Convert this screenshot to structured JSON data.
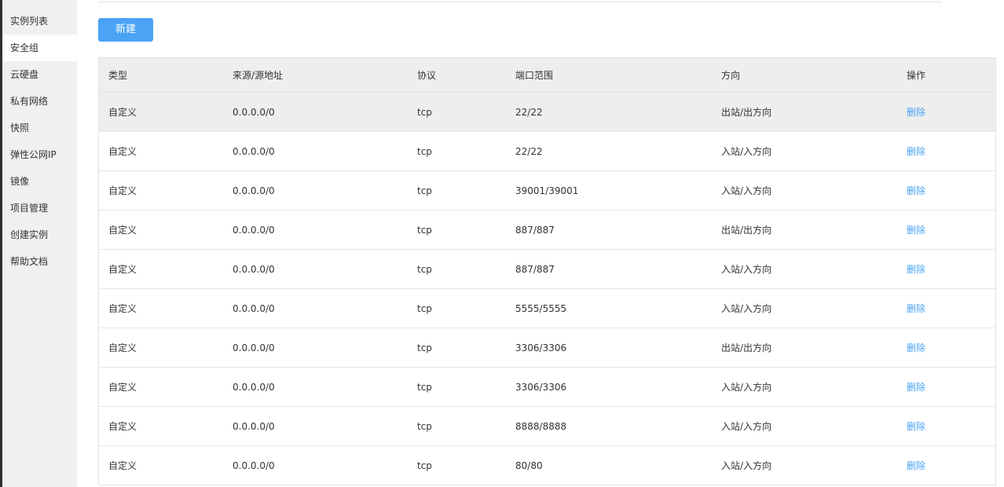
{
  "sidebar": {
    "items": [
      {
        "label": "实例列表"
      },
      {
        "label": "安全组"
      },
      {
        "label": "云硬盘"
      },
      {
        "label": "私有网络"
      },
      {
        "label": "快照"
      },
      {
        "label": "弹性公网IP"
      },
      {
        "label": "镜像"
      },
      {
        "label": "项目管理"
      },
      {
        "label": "创建实例"
      },
      {
        "label": "帮助文档"
      }
    ],
    "active_index": 1
  },
  "toolbar": {
    "new_label": "新建"
  },
  "table": {
    "headers": [
      "类型",
      "来源/源地址",
      "协议",
      "端口范围",
      "方向",
      "操作"
    ],
    "rows": [
      {
        "type": "自定义",
        "source": "0.0.0.0/0",
        "protocol": "tcp",
        "port": "22/22",
        "direction": "出站/出方向",
        "action": "删除"
      },
      {
        "type": "自定义",
        "source": "0.0.0.0/0",
        "protocol": "tcp",
        "port": "22/22",
        "direction": "入站/入方向",
        "action": "删除"
      },
      {
        "type": "自定义",
        "source": "0.0.0.0/0",
        "protocol": "tcp",
        "port": "39001/39001",
        "direction": "入站/入方向",
        "action": "删除"
      },
      {
        "type": "自定义",
        "source": "0.0.0.0/0",
        "protocol": "tcp",
        "port": "887/887",
        "direction": "出站/出方向",
        "action": "删除"
      },
      {
        "type": "自定义",
        "source": "0.0.0.0/0",
        "protocol": "tcp",
        "port": "887/887",
        "direction": "入站/入方向",
        "action": "删除"
      },
      {
        "type": "自定义",
        "source": "0.0.0.0/0",
        "protocol": "tcp",
        "port": "5555/5555",
        "direction": "入站/入方向",
        "action": "删除"
      },
      {
        "type": "自定义",
        "source": "0.0.0.0/0",
        "protocol": "tcp",
        "port": "3306/3306",
        "direction": "出站/出方向",
        "action": "删除"
      },
      {
        "type": "自定义",
        "source": "0.0.0.0/0",
        "protocol": "tcp",
        "port": "3306/3306",
        "direction": "入站/入方向",
        "action": "删除"
      },
      {
        "type": "自定义",
        "source": "0.0.0.0/0",
        "protocol": "tcp",
        "port": "8888/8888",
        "direction": "入站/入方向",
        "action": "删除"
      },
      {
        "type": "自定义",
        "source": "0.0.0.0/0",
        "protocol": "tcp",
        "port": "80/80",
        "direction": "入站/入方向",
        "action": "删除"
      }
    ],
    "highlighted_row_index": 0
  },
  "colors": {
    "accent": "#4aa3f5",
    "sidebar_bg": "#f0f0f0",
    "header_bg": "#eeeeee",
    "left_strip": "#2b2f33"
  }
}
